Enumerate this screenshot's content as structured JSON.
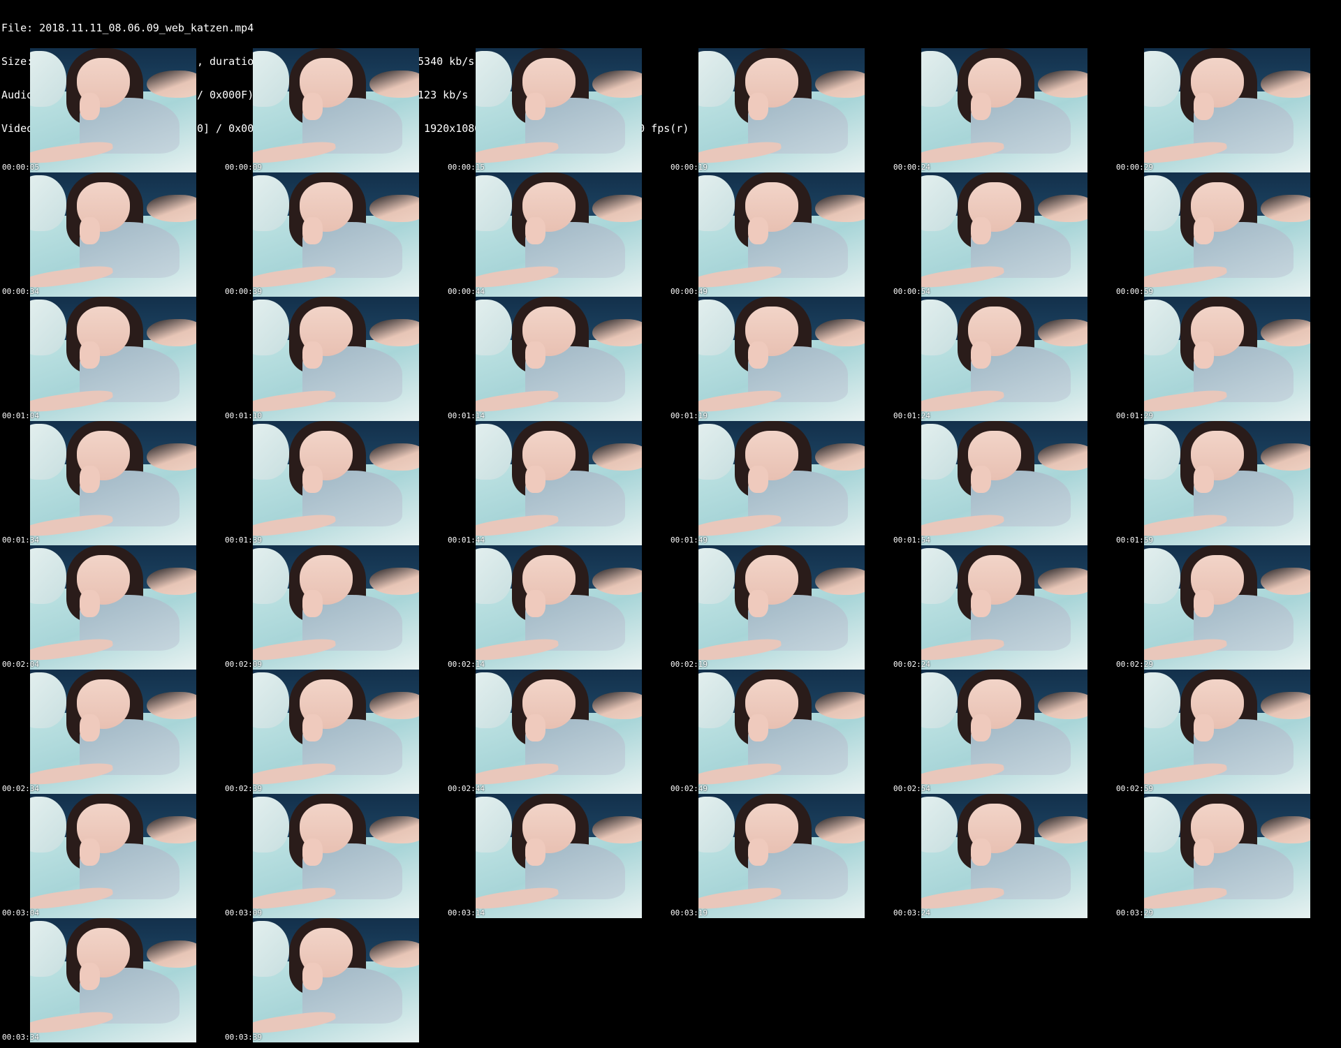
{
  "header": {
    "file_line": "File: 2018.11.11_08.06.09_web_katzen.mp4",
    "size_line": "Size: 164210292 bytes (157 MiB), duration: 00:04:06, avg.bitrate: 5340 kb/s",
    "audio_line": "Audio: aac (LC) ([15][0][0][0] / 0x000F), 44100 Hz, stereo, fltp, 123 kb/s",
    "video_line": "Video: h264 (High) ([27][0][0][0] / 0x001B), yuv420p(progressive), 1920x1080 [SAR 1:1 DAR 16:9], 30.00 fps(r)"
  },
  "thumbnails": [
    {
      "time": "00:00:05"
    },
    {
      "time": "00:00:09"
    },
    {
      "time": "00:00:15"
    },
    {
      "time": "00:00:19"
    },
    {
      "time": "00:00:24"
    },
    {
      "time": "00:00:29"
    },
    {
      "time": "00:00:34"
    },
    {
      "time": "00:00:39"
    },
    {
      "time": "00:00:44"
    },
    {
      "time": "00:00:49"
    },
    {
      "time": "00:00:54"
    },
    {
      "time": "00:00:59"
    },
    {
      "time": "00:01:04"
    },
    {
      "time": "00:01:10"
    },
    {
      "time": "00:01:14"
    },
    {
      "time": "00:01:19"
    },
    {
      "time": "00:01:24"
    },
    {
      "time": "00:01:29"
    },
    {
      "time": "00:01:34"
    },
    {
      "time": "00:01:39"
    },
    {
      "time": "00:01:44"
    },
    {
      "time": "00:01:49"
    },
    {
      "time": "00:01:54"
    },
    {
      "time": "00:01:59"
    },
    {
      "time": "00:02:04"
    },
    {
      "time": "00:02:09"
    },
    {
      "time": "00:02:14"
    },
    {
      "time": "00:02:19"
    },
    {
      "time": "00:02:24"
    },
    {
      "time": "00:02:29"
    },
    {
      "time": "00:02:34"
    },
    {
      "time": "00:02:39"
    },
    {
      "time": "00:02:44"
    },
    {
      "time": "00:02:49"
    },
    {
      "time": "00:02:54"
    },
    {
      "time": "00:02:59"
    },
    {
      "time": "00:03:04"
    },
    {
      "time": "00:03:09"
    },
    {
      "time": "00:03:14"
    },
    {
      "time": "00:03:19"
    },
    {
      "time": "00:03:24"
    },
    {
      "time": "00:03:29"
    },
    {
      "time": "00:03:34"
    },
    {
      "time": "00:03:39"
    }
  ],
  "colors": {
    "background": "#000000",
    "text": "#ffffff"
  }
}
